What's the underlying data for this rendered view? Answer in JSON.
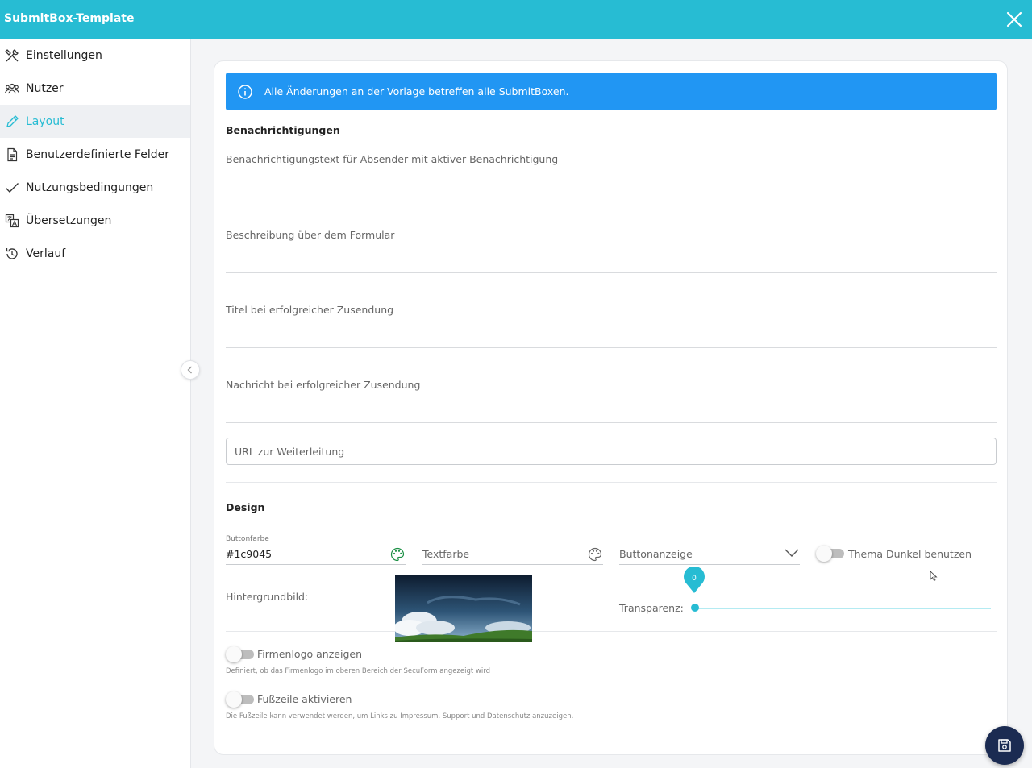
{
  "header": {
    "title": "SubmitBox-Template"
  },
  "sidebar": {
    "items": [
      {
        "label": "Einstellungen",
        "icon": "tools-icon"
      },
      {
        "label": "Nutzer",
        "icon": "users-icon"
      },
      {
        "label": "Layout",
        "icon": "pencil-icon",
        "active": true
      },
      {
        "label": "Benutzerdefinierte Felder",
        "icon": "document-icon"
      },
      {
        "label": "Nutzungsbedingungen",
        "icon": "check-icon"
      },
      {
        "label": "Übersetzungen",
        "icon": "translate-icon"
      },
      {
        "label": "Verlauf",
        "icon": "history-icon"
      }
    ]
  },
  "banner": {
    "text": "Alle Änderungen an der Vorlage betreffen alle SubmitBoxen."
  },
  "notifications": {
    "title": "Benachrichtigungen",
    "fields": [
      "Benachrichtigungstext für Absender mit aktiver Benachrichtigung",
      "Beschreibung über dem Formular",
      "Titel bei erfolgreicher Zusendung",
      "Nachricht bei erfolgreicher Zusendung"
    ],
    "redirect_placeholder": "URL zur Weiterleitung"
  },
  "design": {
    "title": "Design",
    "button_color_label": "Buttonfarbe",
    "button_color_value": "#1c9045",
    "text_color_placeholder": "Textfarbe",
    "button_display_placeholder": "Buttonanzeige",
    "dark_theme_label": "Thema Dunkel benutzen",
    "background_label": "Hintergrundbild:",
    "transparency_label": "Transparenz:",
    "transparency_value": "0"
  },
  "options": {
    "company_logo_label": "Firmenlogo anzeigen",
    "company_logo_help": "Definiert, ob das Firmenlogo im oberen Bereich der SecuForm angezeigt wird",
    "footer_label": "Fußzeile aktivieren",
    "footer_help": "Die Fußzeile kann verwendet werden, um Links zu Impressum, Support und Datenschutz anzuzeigen."
  },
  "colors": {
    "accent": "#27bcd3",
    "banner": "#2196f3",
    "fab": "#1b2b52",
    "palette_active": "#1c9045"
  }
}
